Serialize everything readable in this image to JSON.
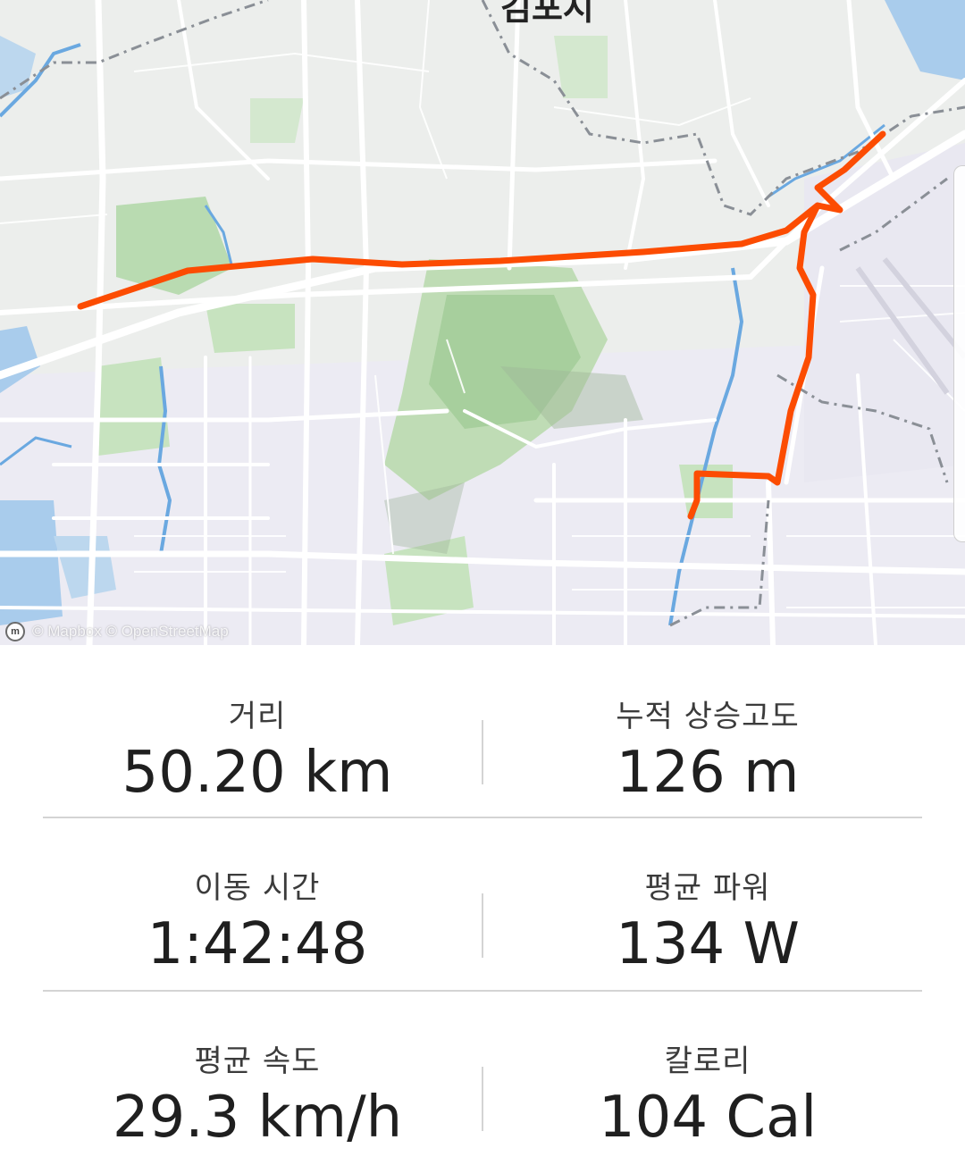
{
  "map": {
    "city_label": "김포시",
    "attribution_logo": "mapbox-logo",
    "attribution": "© Mapbox © OpenStreetMap",
    "route_color": "#fc4c02",
    "water_color": "#3a8fd6"
  },
  "stats": {
    "distance": {
      "label": "거리",
      "value": "50.20 km"
    },
    "elevation": {
      "label": "누적 상승고도",
      "value": "126 m"
    },
    "moving_time": {
      "label": "이동 시간",
      "value": "1:42:48"
    },
    "avg_power": {
      "label": "평균 파워",
      "value": "134 W"
    },
    "avg_speed": {
      "label": "평균 속도",
      "value": "29.3 km/h"
    },
    "calories": {
      "label": "칼로리",
      "value": "104 Cal"
    }
  }
}
